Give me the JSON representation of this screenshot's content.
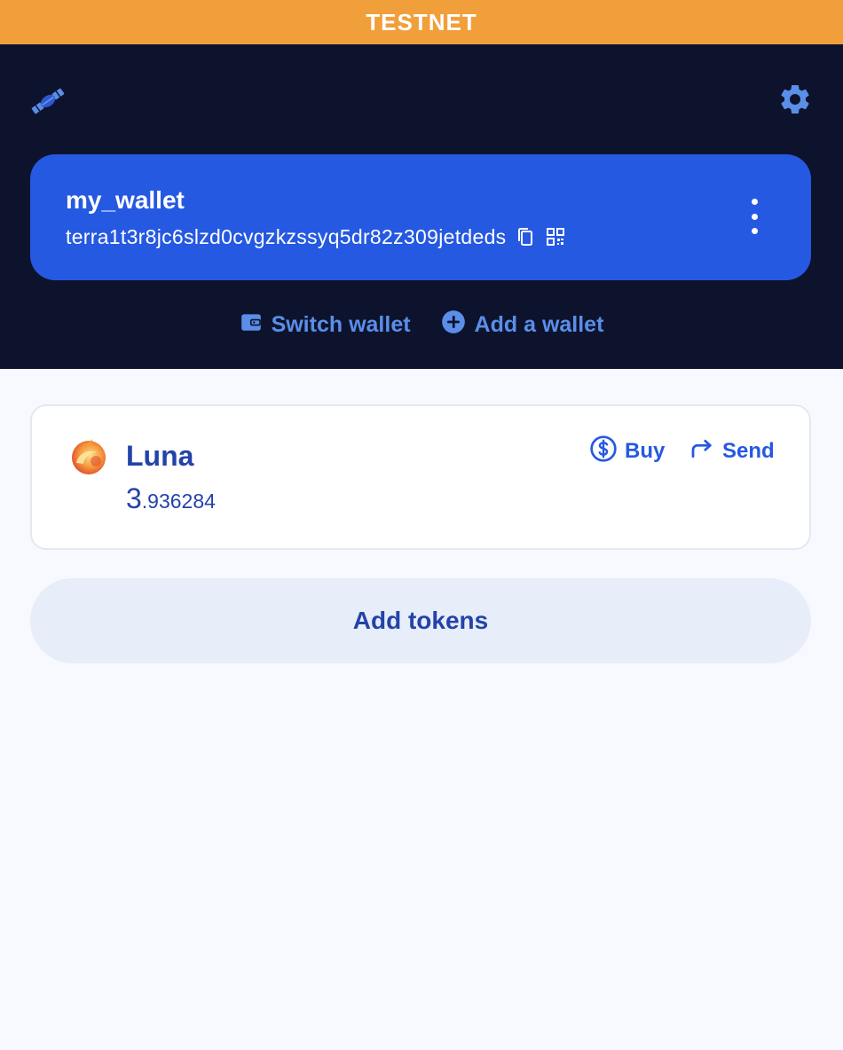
{
  "network_banner": "TESTNET",
  "header": {
    "logo_icon": "satellite-icon",
    "settings_icon": "gear-icon"
  },
  "wallet": {
    "name": "my_wallet",
    "address": "terra1t3r8jc6slzd0cvgzkzssyq5dr82z309jetdeds",
    "copy_icon": "copy-icon",
    "qr_icon": "qr-code-icon",
    "menu_icon": "kebab-menu-icon",
    "card_color": "#2659e1"
  },
  "header_actions": {
    "switch_label": "Switch wallet",
    "add_label": "Add a wallet"
  },
  "token": {
    "name": "Luna",
    "balance_int": "3",
    "balance_dec": ".936284",
    "buy_label": "Buy",
    "send_label": "Send"
  },
  "add_tokens_label": "Add tokens",
  "colors": {
    "banner": "#f09f3a",
    "header_bg": "#0d132c",
    "accent": "#2659e1",
    "text_primary": "#2343a8",
    "header_link": "#5a8ee9"
  }
}
